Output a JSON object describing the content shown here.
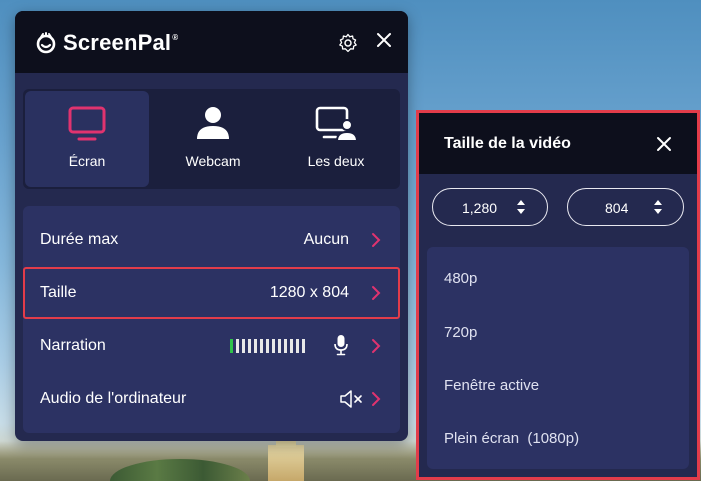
{
  "app": {
    "logo_text": "ScreenPal",
    "logo_screen": "Screen",
    "logo_pal": "Pal",
    "logo_reg": "®"
  },
  "colors": {
    "accent": "#e0336f",
    "highlight": "#e23c4a",
    "panel": "#24294f",
    "header": "#0d0f1c",
    "meter_green": "#2ec34a"
  },
  "modes": [
    {
      "label": "Écran",
      "icon": "monitor-icon",
      "active": true
    },
    {
      "label": "Webcam",
      "icon": "person-icon",
      "active": false
    },
    {
      "label": "Les deux",
      "icon": "monitor-person-icon",
      "active": false
    }
  ],
  "settings": {
    "duration": {
      "label": "Durée max",
      "value": "Aucun"
    },
    "size": {
      "label": "Taille",
      "value": "1280 x 804"
    },
    "narration": {
      "label": "Narration",
      "meter_level": 0.1
    },
    "audio": {
      "label": "Audio de l'ordinateur"
    }
  },
  "video_size": {
    "title": "Taille de la vidéo",
    "width": "1,280",
    "height": "804",
    "options": [
      "480p",
      "720p",
      "Fenêtre active",
      "Plein écran  (1080p)"
    ]
  }
}
